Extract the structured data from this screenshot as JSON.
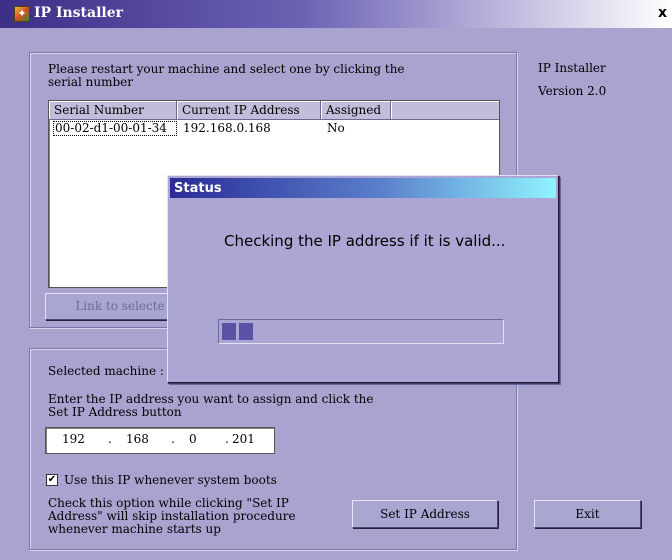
{
  "window": {
    "title": "IP Installer",
    "close_glyph": "x"
  },
  "info": {
    "app_name": "IP Installer",
    "version": "Version 2.0"
  },
  "top_group": {
    "instruction_line1": "Please restart your machine and select one by clicking the",
    "instruction_line2": "serial number",
    "table": {
      "columns": [
        "Serial Number",
        "Current IP Address",
        "Assigned"
      ],
      "rows": [
        [
          "00-02-d1-00-01-34",
          "192.168.0.168",
          "No"
        ]
      ]
    },
    "link_button_label": "Link to selecte"
  },
  "bottom_group": {
    "selected_machine_label": "Selected machine :",
    "enter_ip_line1": "Enter the IP address you want to assign and click the",
    "enter_ip_line2": "Set IP Address button",
    "ip_octets": [
      "192",
      "168",
      "0",
      "201"
    ],
    "ip_dot": ".",
    "checkbox_checked": true,
    "checkbox_mark": "✔",
    "checkbox_label": "Use this IP whenever system boots",
    "note_line1": "Check this option while clicking \"Set IP",
    "note_line2": "Address\" will skip installation procedure",
    "note_line3": "whenever machine starts up",
    "set_ip_button_label": "Set IP Address"
  },
  "exit_button_label": "Exit",
  "status_dialog": {
    "title": "Status",
    "message": "Checking the IP address if it is valid...",
    "progress_blocks_filled": 2
  },
  "colors": {
    "background": "#a8a3cf",
    "title_gradient_start": "#3b2f86",
    "status_title_gradient_start": "#2a2c96",
    "status_title_gradient_end": "#8ff4ff",
    "progress_block": "#5b54a6"
  }
}
